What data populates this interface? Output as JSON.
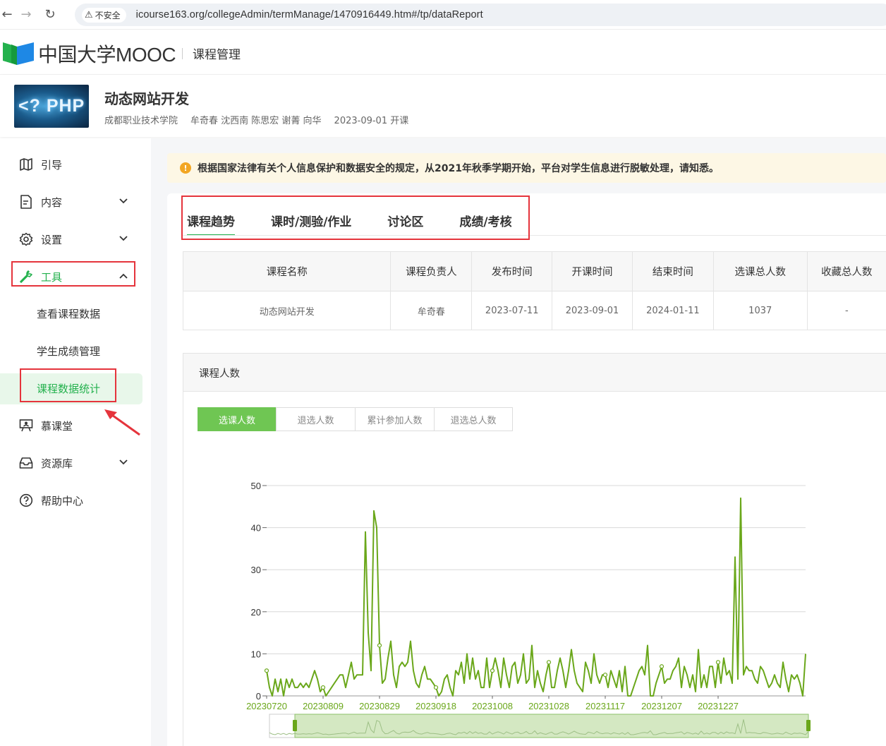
{
  "browser": {
    "back_icon": "arrow-left-icon",
    "forward_icon": "arrow-right-icon",
    "reload_icon": "reload-icon",
    "security_label": "不安全",
    "url": "icourse163.org/collegeAdmin/termManage/1470916449.htm#/tp/dataReport"
  },
  "header": {
    "logo_text": "中国大学MOOC",
    "section": "课程管理"
  },
  "course": {
    "thumb_text": "<? PHP",
    "title": "动态网站开发",
    "school": "成都职业技术学院",
    "teachers": "牟奇春 沈西南 陈思宏 谢菁 向华",
    "start": "2023-09-01 开课"
  },
  "sidebar": {
    "items": [
      {
        "label": "引导",
        "icon": "map-icon"
      },
      {
        "label": "内容",
        "icon": "document-icon"
      },
      {
        "label": "设置",
        "icon": "gear-icon"
      },
      {
        "label": "工具",
        "icon": "wrench-icon"
      },
      {
        "label": "慕课堂",
        "icon": "classroom-icon"
      },
      {
        "label": "资源库",
        "icon": "inbox-icon"
      },
      {
        "label": "帮助中心",
        "icon": "help-icon"
      }
    ],
    "tools_sub": [
      "查看课程数据",
      "学生成绩管理",
      "课程数据统计"
    ]
  },
  "notice": {
    "icon": "warning-icon",
    "text": "根据国家法律有关个人信息保护和数据安全的规定，从2021年秋季学期开始，平台对学生信息进行脱敏处理，请知悉。"
  },
  "tabs": [
    "课程趋势",
    "课时/测验/作业",
    "讨论区",
    "成绩/考核"
  ],
  "table": {
    "headers": [
      "课程名称",
      "课程负责人",
      "发布时间",
      "开课时间",
      "结束时间",
      "选课总人数",
      "收藏总人数"
    ],
    "row": [
      "动态网站开发",
      "牟奇春",
      "2023-07-11",
      "2023-09-01",
      "2024-01-11",
      "1037",
      "-"
    ]
  },
  "chart_section": {
    "title": "课程人数",
    "segments": [
      "选课人数",
      "退选人数",
      "累计参加人数",
      "退选总人数"
    ],
    "active_segment": "选课人数"
  },
  "chart_data": {
    "type": "line",
    "x_tick_labels": [
      "20230720",
      "20230809",
      "20230829",
      "20230918",
      "20231008",
      "20231028",
      "20231117",
      "20231207",
      "20231227"
    ],
    "y_ticks": [
      0,
      10,
      20,
      30,
      40,
      50
    ],
    "ylim": [
      0,
      50
    ],
    "grid": true,
    "line_color": "#6aa71a",
    "series": [
      {
        "values": [
          6,
          2,
          0,
          4,
          1,
          4,
          0,
          4,
          2,
          4,
          2,
          2,
          3,
          2,
          3,
          2,
          4,
          6,
          4,
          1,
          2,
          0,
          1,
          2,
          3,
          4,
          5,
          5,
          2,
          5,
          8,
          4,
          5,
          5,
          5,
          39,
          15,
          6,
          44,
          40,
          12,
          3,
          4,
          9,
          13,
          5,
          2,
          7,
          8,
          7,
          8,
          13,
          6,
          3,
          2,
          5,
          7,
          4,
          4,
          3,
          2,
          0,
          1,
          4,
          5,
          2,
          0,
          6,
          5,
          8,
          3,
          10,
          4,
          9,
          4,
          6,
          2,
          2,
          9,
          2,
          6,
          9,
          6,
          2,
          9,
          5,
          2,
          7,
          8,
          3,
          5,
          10,
          3,
          4,
          12,
          2,
          6,
          3,
          1,
          5,
          8,
          2,
          2,
          6,
          9,
          6,
          2,
          6,
          11,
          6,
          3,
          2,
          1,
          8,
          6,
          3,
          10,
          5,
          3,
          5,
          5,
          2,
          6,
          4,
          2,
          6,
          1,
          7,
          0,
          0,
          2,
          4,
          6,
          7,
          5,
          12,
          0,
          0,
          3,
          5,
          7,
          3,
          4,
          4,
          6,
          7,
          9,
          2,
          7,
          5,
          2,
          5,
          1,
          11,
          2,
          5,
          2,
          7,
          7,
          2,
          8,
          3,
          9,
          5,
          6,
          3,
          33,
          4,
          47,
          5,
          7,
          6,
          6,
          4,
          3,
          7,
          6,
          4,
          2,
          3,
          5,
          3,
          2,
          8,
          4,
          1,
          5,
          4,
          5,
          3,
          0,
          10
        ],
        "markers": [
          0,
          20,
          40,
          60,
          80,
          100,
          120,
          140,
          160
        ]
      }
    ]
  }
}
